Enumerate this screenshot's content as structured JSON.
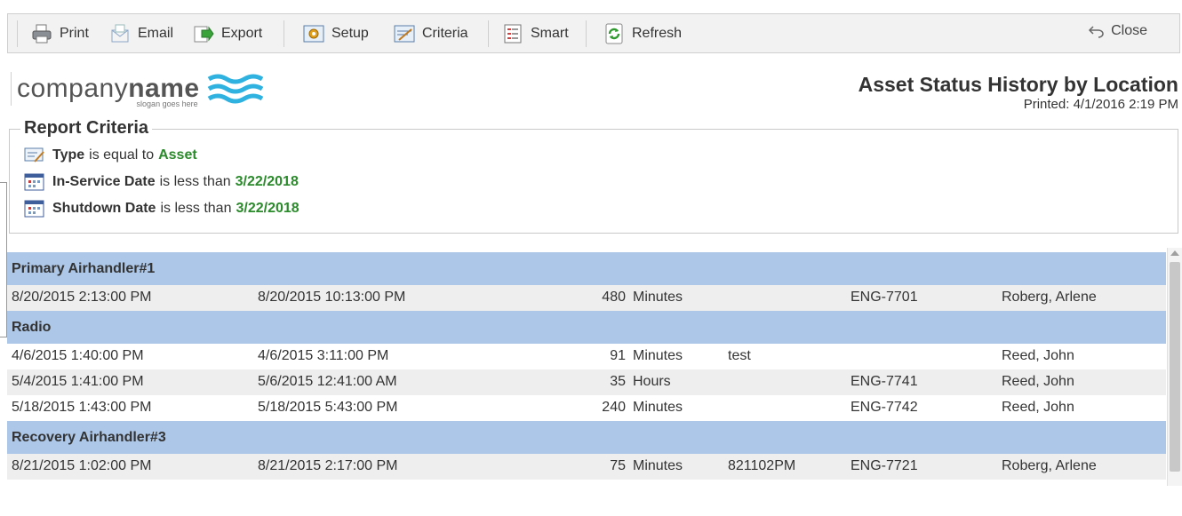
{
  "toolbar": {
    "print": "Print",
    "email": "Email",
    "export": "Export",
    "setup": "Setup",
    "criteria": "Criteria",
    "smart": "Smart",
    "refresh": "Refresh",
    "close": "Close"
  },
  "logo": {
    "light": "company",
    "bold": "name",
    "slogan": "slogan goes here"
  },
  "report": {
    "title": "Asset Status History by Location",
    "printed": "Printed: 4/1/2016  2:19 PM"
  },
  "criteria": {
    "legend": "Report Criteria",
    "items": [
      {
        "field": "Type",
        "op": "is equal to",
        "value": "Asset",
        "icon": "type-icon"
      },
      {
        "field": "In-Service Date",
        "op": "is less than",
        "value": "3/22/2018",
        "icon": "calendar-icon"
      },
      {
        "field": "Shutdown Date",
        "op": "is less than",
        "value": "3/22/2018",
        "icon": "calendar-icon"
      }
    ]
  },
  "groups": [
    {
      "name": "Primary Airhandler#1",
      "rows": [
        {
          "start": "8/20/2015 2:13:00 PM",
          "end": "8/20/2015 10:13:00 PM",
          "qty": "480",
          "unit": "Minutes",
          "note": "",
          "wo": "ENG-7701",
          "by": "Roberg, Arlene"
        }
      ]
    },
    {
      "name": "Radio",
      "rows": [
        {
          "start": "4/6/2015 1:40:00 PM",
          "end": "4/6/2015 3:11:00 PM",
          "qty": "91",
          "unit": "Minutes",
          "note": "test",
          "wo": "",
          "by": "Reed, John"
        },
        {
          "start": "5/4/2015 1:41:00 PM",
          "end": "5/6/2015 12:41:00 AM",
          "qty": "35",
          "unit": "Hours",
          "note": "",
          "wo": "ENG-7741",
          "by": "Reed, John"
        },
        {
          "start": "5/18/2015 1:43:00 PM",
          "end": "5/18/2015 5:43:00 PM",
          "qty": "240",
          "unit": "Minutes",
          "note": "",
          "wo": "ENG-7742",
          "by": "Reed, John"
        }
      ]
    },
    {
      "name": "Recovery Airhandler#3",
      "rows": [
        {
          "start": "8/21/2015 1:02:00 PM",
          "end": "8/21/2015 2:17:00 PM",
          "qty": "75",
          "unit": "Minutes",
          "note": "821102PM",
          "wo": "ENG-7721",
          "by": "Roberg, Arlene"
        }
      ]
    }
  ],
  "colors": {
    "group_header": "#adc7e8",
    "criteria_value": "#2b8a2b",
    "logo_wave": "#2fb2e0"
  }
}
